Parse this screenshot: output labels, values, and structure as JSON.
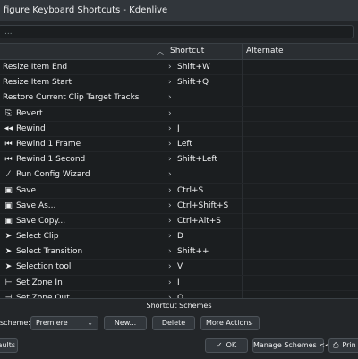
{
  "window": {
    "title": "figure Keyboard Shortcuts - Kdenlive"
  },
  "search": {
    "placeholder": "..."
  },
  "table": {
    "columns": [
      "Shortcut",
      "Alternate"
    ],
    "rows": [
      {
        "icon": "",
        "name": "Resize Item End",
        "shortcut": "Shift+W"
      },
      {
        "icon": "",
        "name": "Resize Item Start",
        "shortcut": "Shift+Q"
      },
      {
        "icon": "",
        "name": "Restore Current Clip Target Tracks",
        "shortcut": ""
      },
      {
        "icon": "revert-icon",
        "name": "Revert",
        "shortcut": ""
      },
      {
        "icon": "rewind-icon",
        "name": "Rewind",
        "shortcut": "J"
      },
      {
        "icon": "rewind-frame-icon",
        "name": "Rewind 1 Frame",
        "shortcut": "Left"
      },
      {
        "icon": "rewind-second-icon",
        "name": "Rewind 1 Second",
        "shortcut": "Shift+Left"
      },
      {
        "icon": "wand-icon",
        "name": "Run Config Wizard",
        "shortcut": ""
      },
      {
        "icon": "save-icon",
        "name": "Save",
        "shortcut": "Ctrl+S"
      },
      {
        "icon": "save-as-icon",
        "name": "Save As...",
        "shortcut": "Ctrl+Shift+S"
      },
      {
        "icon": "save-copy-icon",
        "name": "Save Copy...",
        "shortcut": "Ctrl+Alt+S"
      },
      {
        "icon": "select-clip-icon",
        "name": "Select Clip",
        "shortcut": "D"
      },
      {
        "icon": "select-transition-icon",
        "name": "Select Transition",
        "shortcut": "Shift++"
      },
      {
        "icon": "selection-tool-icon",
        "name": "Selection tool",
        "shortcut": "V"
      },
      {
        "icon": "zone-in-icon",
        "name": "Set Zone In",
        "shortcut": "I"
      },
      {
        "icon": "zone-out-icon",
        "name": "Set Zone Out",
        "shortcut": "O"
      }
    ]
  },
  "schemes": {
    "group_label": "Shortcut Schemes",
    "scheme_label": "scheme:",
    "selected": "Premiere",
    "new_label": "New...",
    "delete_label": "Delete",
    "more_label": "More Actions"
  },
  "footer": {
    "defaults_label": "aults",
    "ok_label": "OK",
    "manage_label": "Manage Schemes <<",
    "print_label": "Prin"
  },
  "colors": {
    "background": "#232629",
    "table_bg": "#1b1e20",
    "text": "#eff0f1"
  }
}
